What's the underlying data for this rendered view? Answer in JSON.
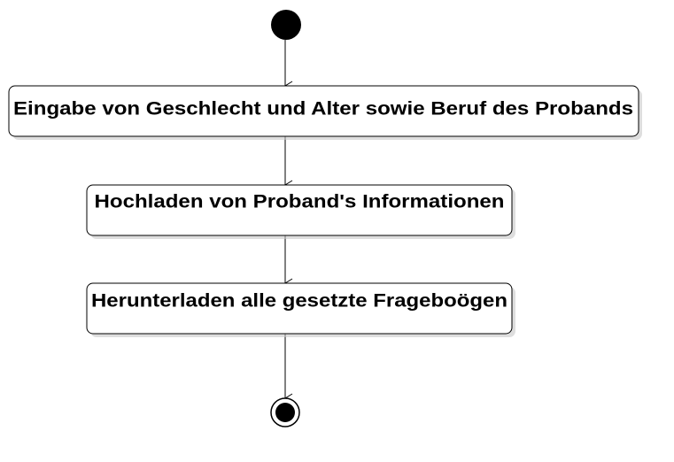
{
  "diagram": {
    "type": "activity",
    "actions": [
      {
        "label": "Eingabe von Geschlecht und Alter sowie Beruf des Probands"
      },
      {
        "label": "Hochladen von Proband's Informationen"
      },
      {
        "label": "Herunterladen alle gesetzte Frageboögen"
      }
    ],
    "colors": {
      "stroke": "#000000",
      "fill": "#ffffff",
      "shadow": "#c8c8c8",
      "node": "#000000"
    }
  }
}
